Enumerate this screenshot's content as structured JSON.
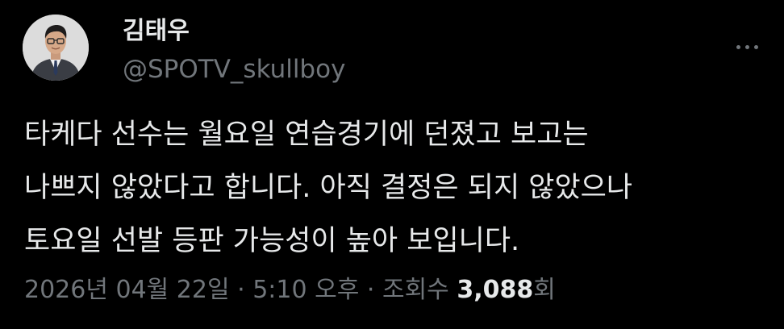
{
  "author": {
    "display_name": "김태우",
    "handle": "@SPOTV_skullboy"
  },
  "more_icon": "more-horizontal-icon",
  "tweet": {
    "lines": [
      "타케다 선수는 월요일 연습경기에 던졌고 보고는",
      "나쁘지 않았다고 합니다. 아직 결정은 되지 않았으나",
      "토요일 선발 등판 가능성이 높아 보입니다."
    ]
  },
  "meta": {
    "date": "2026년 04월 22일",
    "separator": "·",
    "time": "5:10 오후",
    "views_label": "조회수",
    "views_count": "3,088",
    "views_suffix": "회"
  },
  "colors": {
    "background": "#000000",
    "primary_text": "#e7e9ea",
    "secondary_text": "#71767b"
  }
}
